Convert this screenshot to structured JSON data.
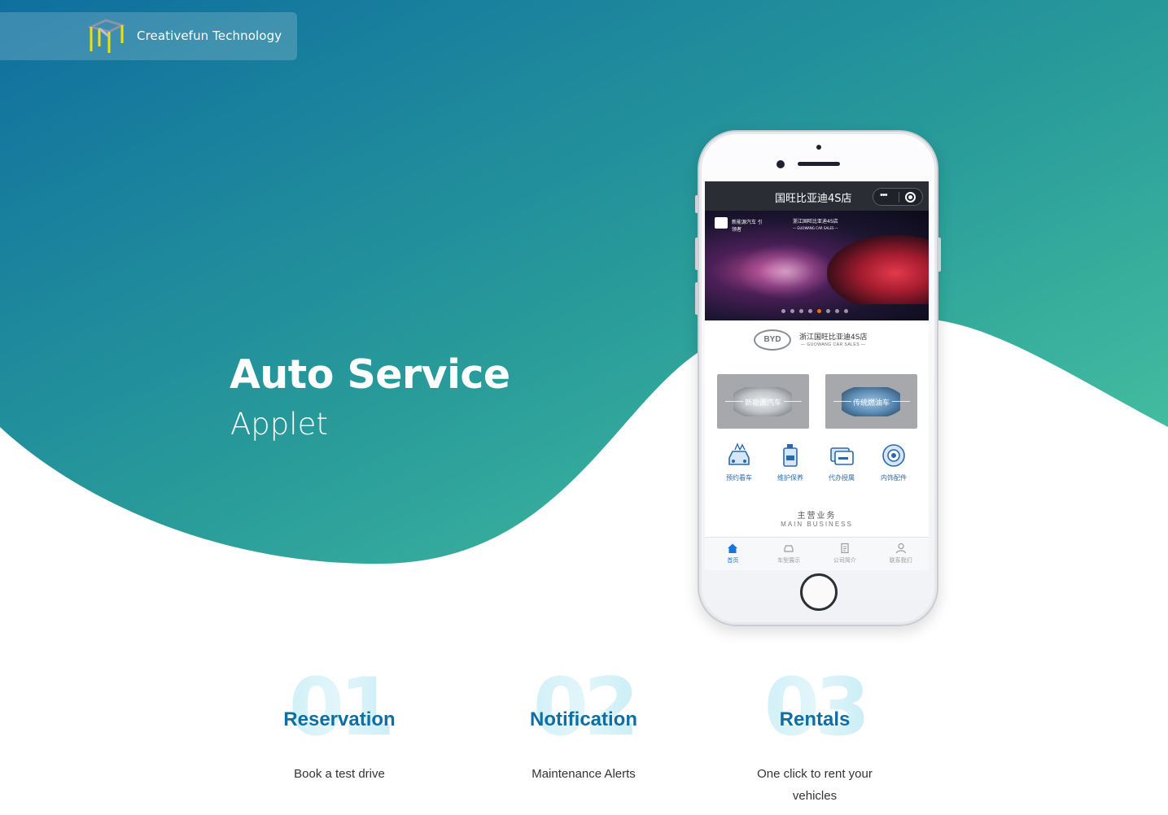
{
  "brand": {
    "name": "Creativefun Technology"
  },
  "hero": {
    "title": "Auto Service",
    "subtitle": "Applet"
  },
  "colors": {
    "gradient_start": "#0f6f9f",
    "gradient_end": "#45c4a2",
    "accent": "#0e6fa6"
  },
  "phone_app": {
    "title": "国旺比亚迪4S店",
    "banner": {
      "tag_left": "新能源汽车 引领者",
      "tag_right": "浙江国旺比亚迪4S店",
      "tag_right_sub": "— GUOWANG CAR SALES —",
      "slide_count": 8,
      "active_slide": 5
    },
    "store": {
      "name": "浙江国旺比亚迪4S店",
      "subtitle": "— GUOWANG CAR SALES —",
      "logo_text": "BYD"
    },
    "car_cards": [
      {
        "label": "新能源汽车"
      },
      {
        "label": "传统燃油车"
      }
    ],
    "services": [
      {
        "label": "预约看车",
        "icon": "car-wash-icon"
      },
      {
        "label": "维护保养",
        "icon": "oil-can-icon"
      },
      {
        "label": "代办授属",
        "icon": "card-icon"
      },
      {
        "label": "内饰配件",
        "icon": "wheel-icon"
      }
    ],
    "main_business": {
      "cn": "主营业务",
      "en": "MAIN BUSINESS"
    },
    "tabs": [
      {
        "label": "首页",
        "icon": "home-icon",
        "active": true
      },
      {
        "label": "车型展示",
        "icon": "car-icon",
        "active": false
      },
      {
        "label": "公司简介",
        "icon": "document-icon",
        "active": false
      },
      {
        "label": "联系我们",
        "icon": "user-icon",
        "active": false
      }
    ]
  },
  "features": [
    {
      "number": "01",
      "title": "Reservation",
      "description": "Book a  test drive"
    },
    {
      "number": "02",
      "title": "Notification",
      "description": "Maintenance Alerts"
    },
    {
      "number": "03",
      "title": "Rentals",
      "description": "One click to rent your vehicles"
    }
  ]
}
